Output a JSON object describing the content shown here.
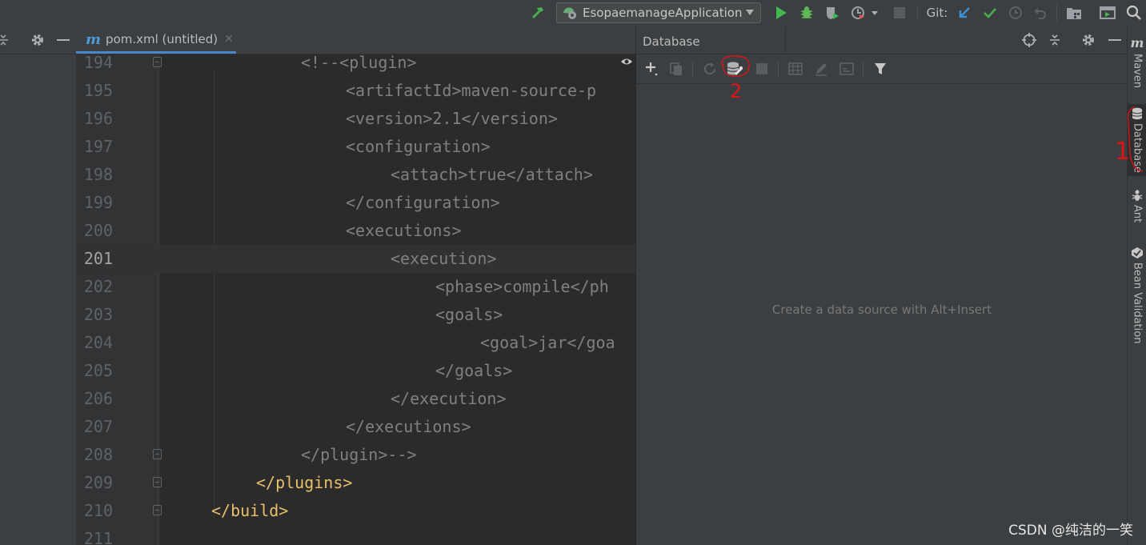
{
  "toolbar": {
    "run_config_label": "EsopaemanageApplication",
    "git_label": "Git:"
  },
  "editor": {
    "tab_label": "pom.xml (untitled)",
    "lines": [
      {
        "num": "194",
        "code": "<!--<plugin>"
      },
      {
        "num": "195",
        "code": "<artifactId>maven-source-p"
      },
      {
        "num": "196",
        "code": "<version>2.1</version>"
      },
      {
        "num": "197",
        "code": "<configuration>"
      },
      {
        "num": "198",
        "code": "<attach>true</attach>"
      },
      {
        "num": "199",
        "code": "</configuration>"
      },
      {
        "num": "200",
        "code": "<executions>"
      },
      {
        "num": "201",
        "code": "<execution>"
      },
      {
        "num": "202",
        "code": "<phase>compile</ph"
      },
      {
        "num": "203",
        "code": "<goals>"
      },
      {
        "num": "204",
        "code": "<goal>jar</goa"
      },
      {
        "num": "205",
        "code": "</goals>"
      },
      {
        "num": "206",
        "code": "</execution>"
      },
      {
        "num": "207",
        "code": "</executions>"
      },
      {
        "num": "208",
        "code": "</plugin>-->"
      },
      {
        "num": "209",
        "code": "</plugins>"
      },
      {
        "num": "210",
        "code": "</build>"
      },
      {
        "num": "211",
        "code": ""
      }
    ]
  },
  "database_panel": {
    "title": "Database",
    "empty_text": "Create a data source with Alt+Insert"
  },
  "right_stripe": {
    "tabs": [
      {
        "label": "Maven",
        "icon": "maven-icon"
      },
      {
        "label": "Database",
        "icon": "database-icon"
      },
      {
        "label": "Ant",
        "icon": "ant-icon"
      },
      {
        "label": "Bean Validation",
        "icon": "bean-validation-icon"
      }
    ]
  },
  "annotations": {
    "marker_1": "1",
    "marker_2": "2",
    "color": "#e01414"
  },
  "watermark": "CSDN @纯洁的一笑",
  "colors": {
    "background": "#2b2b2b",
    "panel": "#3c3f41",
    "comment": "#808080",
    "tag": "#e8bf6a",
    "run_green": "#3fb950",
    "accent_blue": "#4a88c7"
  }
}
